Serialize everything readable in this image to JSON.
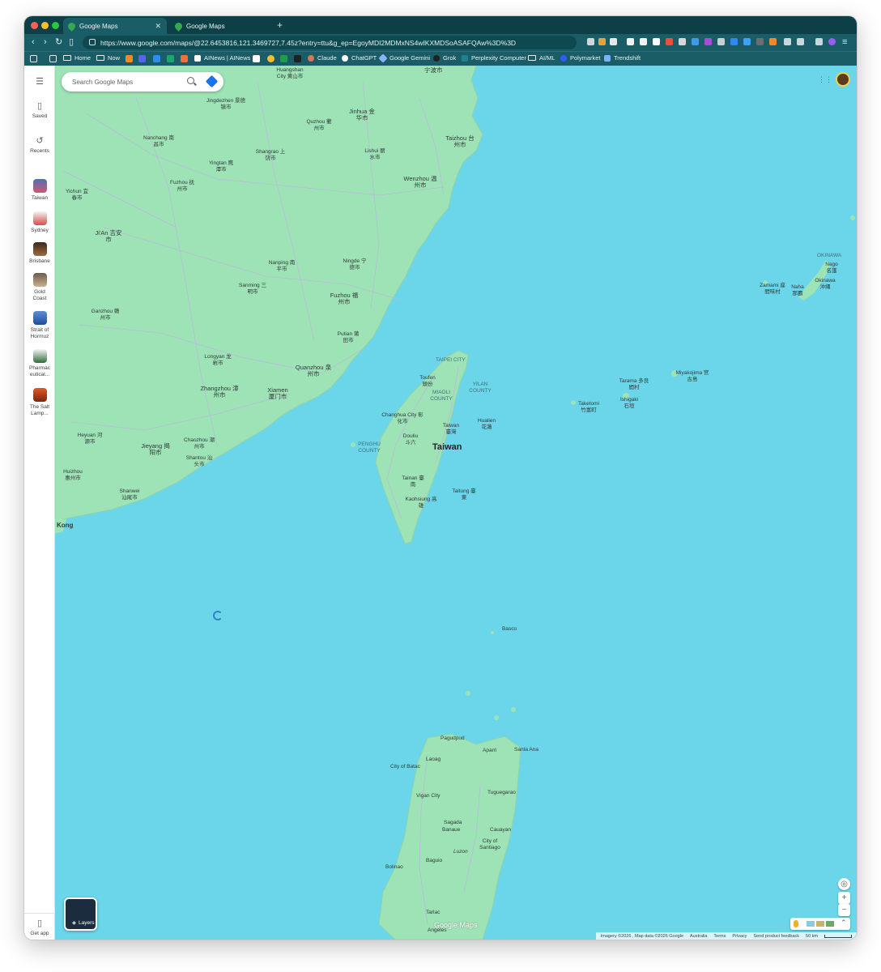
{
  "browser": {
    "tabs": [
      {
        "title": "Google Maps",
        "active": true
      },
      {
        "title": "Google Maps",
        "active": false
      }
    ],
    "url": "https://www.google.com/maps/@22.6453816,121.3469727,7.45z?entry=ttu&g_ep=EgoyMDI2MDMxNS4wIKXMDSoASAFQAw%3D%3D",
    "bookmarks": [
      "Home",
      "Now",
      "AINews | AINews",
      "Claude",
      "ChatGPT",
      "Google Gemini",
      "Grok",
      "Perplexity Computer",
      "AI/ML",
      "Polymarket",
      "Trendshift"
    ]
  },
  "sidebar": {
    "menu_icon": "hamburger-icon",
    "saved": "Saved",
    "recents": "Recents",
    "places": [
      "Taiwan",
      "Sydney",
      "Brisbane",
      "Gold Coast",
      "Strait of Hormuz",
      "Pharmac eutical...",
      "The Salt Lamp..."
    ],
    "get_app": "Get app"
  },
  "search": {
    "placeholder": "Search Google Maps"
  },
  "map": {
    "labels": {
      "huangshan": "Huangshan City 黄山市",
      "ningbo": "宁波市",
      "jingdezhen": "Jingdezhen 景德镇市",
      "jinhua": "Jinhua 金华市",
      "quzhou": "Quzhou 衢州市",
      "taizhou": "Taizhou 台州市",
      "nanchang": "Nanchang 南昌市",
      "yingtan": "Yingtan 鹰潭市",
      "shangrao": "Shangrao 上饶市",
      "lishui": "Lishui 丽水市",
      "wenzhou": "Wenzhou 温州市",
      "fuzhou_jx": "Fuzhou 抚州市",
      "yichun": "Yichun 宜春市",
      "jian": "Ji'An 吉安市",
      "nanping": "Nanping 南平市",
      "ningde": "Ningde 宁德市",
      "sanming": "Sanming 三明市",
      "fuzhou": "Fuzhou 福州市",
      "ganzhou": "Ganzhou 赣州市",
      "putian": "Putian 莆田市",
      "longyan": "Longyan 龙岩市",
      "quanzhou": "Quanzhou 泉州市",
      "zhangzhou": "Zhangzhou 漳州市",
      "xiamen": "Xiamen 厦门市",
      "heyuan": "Heyuan 河源市",
      "jieyang": "Jieyang 揭阳市",
      "chaozhou": "Chaozhou 潮州市",
      "shantou": "Shantou 汕头市",
      "huizhou": "Huizhou 惠州市",
      "shanwei": "Shanwei 汕尾市",
      "kong": "Kong",
      "taipei": "TAIPEI CITY",
      "toufen": "Toufen 頭份",
      "yilan": "YILAN COUNTY",
      "miaoli": "MIAOLI COUNTY",
      "changhua": "Changhua City 彰化市",
      "taiwan_city": "Taiwan 臺灣",
      "hualien": "Hualien 花蓮",
      "penghu": "PENGHU COUNTY",
      "douliu": "Douliu 斗六",
      "taiwan": "Taiwan",
      "tainan": "Tainan 臺南",
      "kaohsiung": "Kaohsiung 高雄",
      "taitung": "Taitung 臺東",
      "okinawa": "OKINAWA",
      "nago": "Nago 名護",
      "zamami": "Zamami 座間味村",
      "naha": "Naha 那覇",
      "okinawa_city": "Okinawa 沖縄",
      "miyakojima": "Miyakojima 宮古島",
      "tarama": "Tarama 多良間村",
      "ishigaki": "Ishigaki 石垣",
      "taketomi": "Taketomi 竹富町",
      "basco": "Basco",
      "pagudpud": "Pagudpud",
      "aparri": "Aparri",
      "santa_ana": "Santa Ana",
      "laoag": "Laoag",
      "batac": "City of Batac",
      "tuguegarao": "Tuguegarao",
      "vigan": "Vigan City",
      "sagada": "Sagada",
      "banaue": "Banaue",
      "cauayan": "Cauayan",
      "santiago": "City of Santiago",
      "luzon": "Luzon",
      "baguio": "Baguio",
      "bolinao": "Bolinao",
      "tarlac": "Tarlac",
      "angeles": "Angeles"
    }
  },
  "layers": {
    "label": "Layers"
  },
  "logo": "Google Maps",
  "footer": {
    "imagery": "Imagery ©2026 , Map data ©2026 Google",
    "country": "Australia",
    "terms": "Terms",
    "privacy": "Privacy",
    "feedback": "Send product feedback",
    "scale": "50 km"
  },
  "colors": {
    "sea": "#6bd6ea",
    "land": "#9ee3b5",
    "chrome": "#1b5d66"
  }
}
